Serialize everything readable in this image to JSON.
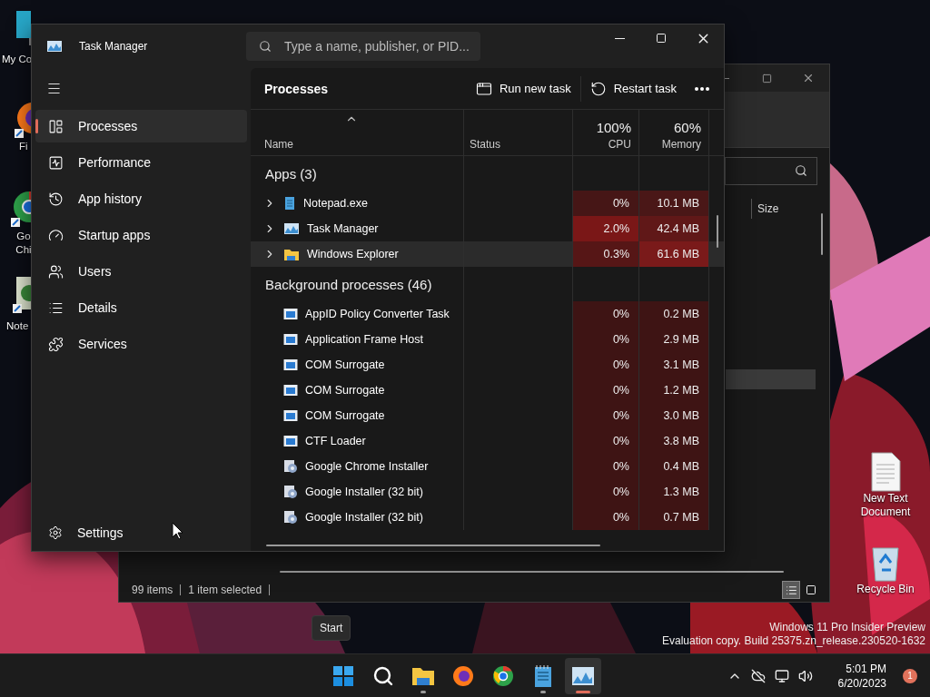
{
  "desktop_icons_left": [
    {
      "label": "My Co",
      "kind": "computer"
    },
    {
      "label": "Fi",
      "kind": "firefox"
    },
    {
      "label": "Go Chi",
      "kind": "chrome"
    },
    {
      "label": "Note",
      "kind": "notepad"
    }
  ],
  "desktop_icons_right": [
    {
      "label": "New Text Document",
      "kind": "text-file"
    },
    {
      "label": "Recycle Bin",
      "kind": "recycle-bin"
    }
  ],
  "explorer": {
    "column": "Size",
    "status": [
      "99 items",
      "1 item selected"
    ],
    "views": [
      {
        "kind": "details",
        "selected": true
      },
      {
        "kind": "tiles",
        "selected": false
      }
    ]
  },
  "task_manager": {
    "title": "Task Manager",
    "search": {
      "placeholder": "Type a name, publisher, or PID..."
    },
    "nav": [
      {
        "label": "Processes",
        "kind": "processes",
        "selected": true
      },
      {
        "label": "Performance",
        "kind": "performance",
        "selected": false
      },
      {
        "label": "App history",
        "kind": "history",
        "selected": false
      },
      {
        "label": "Startup apps",
        "kind": "startup",
        "selected": false
      },
      {
        "label": "Users",
        "kind": "users",
        "selected": false
      },
      {
        "label": "Details",
        "kind": "details",
        "selected": false
      },
      {
        "label": "Services",
        "kind": "services",
        "selected": false
      }
    ],
    "settings": "Settings",
    "page_title": "Processes",
    "actions": [
      {
        "label": "Run new task",
        "kind": "run"
      },
      {
        "label": "Restart task",
        "kind": "restart"
      }
    ],
    "columns": [
      {
        "label": "Name"
      },
      {
        "label": "Status"
      },
      {
        "label": "CPU",
        "total": "100%"
      },
      {
        "label": "Memory",
        "total": "60%"
      }
    ],
    "groups": [
      {
        "title": "Apps (3)",
        "rows": [
          {
            "name": "Notepad.exe",
            "kind": "notepad",
            "expandable": true,
            "selected": false,
            "cpu": {
              "value": "0%",
              "color": "#461616"
            },
            "memory": {
              "value": "10.1 MB",
              "color": "#4a1717"
            }
          },
          {
            "name": "Task Manager",
            "kind": "taskmanager",
            "expandable": true,
            "selected": false,
            "cpu": {
              "value": "2.0%",
              "color": "#7a1717"
            },
            "memory": {
              "value": "42.4 MB",
              "color": "#601818"
            }
          },
          {
            "name": "Windows Explorer",
            "kind": "folder",
            "expandable": true,
            "selected": true,
            "cpu": {
              "value": "0.3%",
              "color": "#561616"
            },
            "memory": {
              "value": "61.6 MB",
              "color": "#7a1a1a"
            }
          }
        ]
      },
      {
        "title": "Background processes (46)",
        "rows": [
          {
            "name": "AppID Policy Converter Task",
            "kind": "window",
            "expandable": false,
            "selected": false,
            "cpu": {
              "value": "0%",
              "color": "#3e1414"
            },
            "memory": {
              "value": "0.2 MB",
              "color": "#3e1414"
            }
          },
          {
            "name": "Application Frame Host",
            "kind": "window",
            "expandable": false,
            "selected": false,
            "cpu": {
              "value": "0%",
              "color": "#3e1414"
            },
            "memory": {
              "value": "2.9 MB",
              "color": "#3e1414"
            }
          },
          {
            "name": "COM Surrogate",
            "kind": "window",
            "expandable": false,
            "selected": false,
            "cpu": {
              "value": "0%",
              "color": "#3e1414"
            },
            "memory": {
              "value": "3.1 MB",
              "color": "#3e1414"
            }
          },
          {
            "name": "COM Surrogate",
            "kind": "window",
            "expandable": false,
            "selected": false,
            "cpu": {
              "value": "0%",
              "color": "#3e1414"
            },
            "memory": {
              "value": "1.2 MB",
              "color": "#3e1414"
            }
          },
          {
            "name": "COM Surrogate",
            "kind": "window",
            "expandable": false,
            "selected": false,
            "cpu": {
              "value": "0%",
              "color": "#3e1414"
            },
            "memory": {
              "value": "3.0 MB",
              "color": "#3e1414"
            }
          },
          {
            "name": "CTF Loader",
            "kind": "window",
            "expandable": false,
            "selected": false,
            "cpu": {
              "value": "0%",
              "color": "#3e1414"
            },
            "memory": {
              "value": "3.8 MB",
              "color": "#3e1414"
            }
          },
          {
            "name": "Google Chrome Installer",
            "kind": "installer",
            "expandable": false,
            "selected": false,
            "cpu": {
              "value": "0%",
              "color": "#3e1414"
            },
            "memory": {
              "value": "0.4 MB",
              "color": "#3e1414"
            }
          },
          {
            "name": "Google Installer (32 bit)",
            "kind": "installer",
            "expandable": false,
            "selected": false,
            "cpu": {
              "value": "0%",
              "color": "#3e1414"
            },
            "memory": {
              "value": "1.3 MB",
              "color": "#3e1414"
            }
          },
          {
            "name": "Google Installer (32 bit)",
            "kind": "installer",
            "expandable": false,
            "selected": false,
            "cpu": {
              "value": "0%",
              "color": "#3e1414"
            },
            "memory": {
              "value": "0.7 MB",
              "color": "#3e1414"
            }
          }
        ]
      }
    ]
  },
  "start_tooltip": "Start",
  "watermark": [
    "Windows 11 Pro Insider Preview",
    "Evaluation copy. Build 25375.zn_release.230520-1632"
  ],
  "taskbar": {
    "apps": [
      {
        "kind": "start",
        "running": false,
        "selected": false
      },
      {
        "kind": "search",
        "running": false,
        "selected": false
      },
      {
        "kind": "explorer",
        "running": true,
        "selected": false
      },
      {
        "kind": "firefox",
        "running": false,
        "selected": false
      },
      {
        "kind": "chrome",
        "running": false,
        "selected": false
      },
      {
        "kind": "notepad",
        "running": true,
        "selected": false
      },
      {
        "kind": "taskmanager",
        "running": true,
        "selected": true
      }
    ],
    "time": "5:01 PM",
    "date": "6/20/2023",
    "notifications": "1"
  }
}
